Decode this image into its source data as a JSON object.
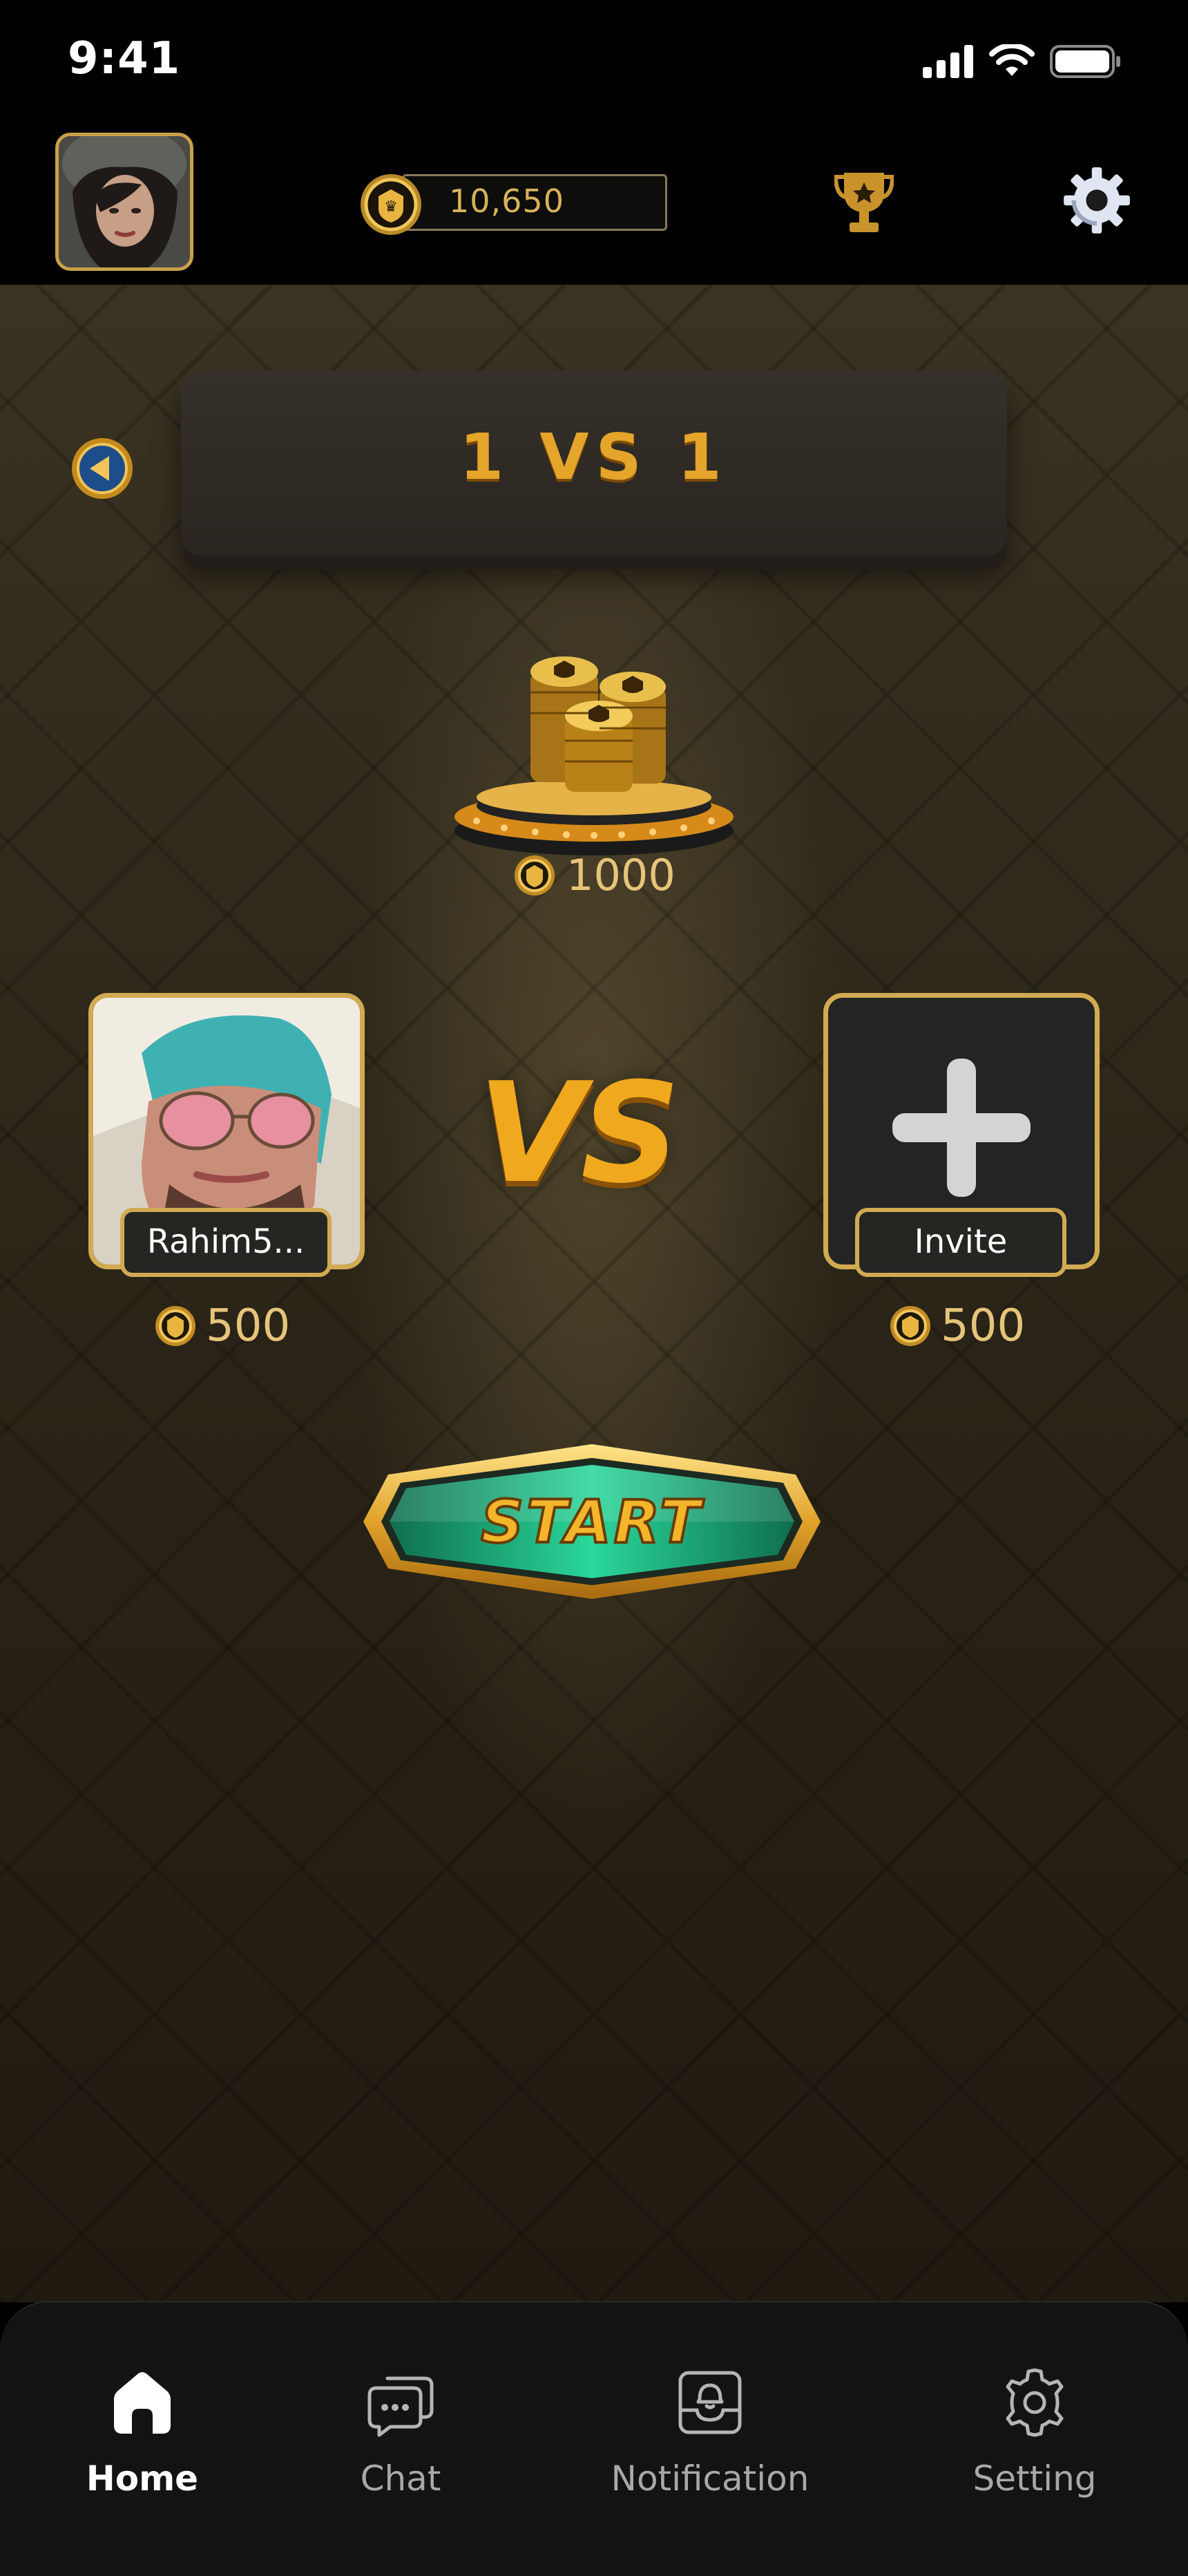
{
  "status_bar": {
    "time": "9:41"
  },
  "top_bar": {
    "coin_balance": "10,650"
  },
  "game": {
    "mode_title": "1 VS 1",
    "pot_amount": "1000",
    "vs_label": "VS",
    "player_left": {
      "name": "Rahim5...",
      "bet": "500"
    },
    "player_right": {
      "name": "Invite",
      "bet": "500"
    },
    "start_label": "START"
  },
  "nav": {
    "items": [
      {
        "label": "Home",
        "icon": "home-icon",
        "active": true
      },
      {
        "label": "Chat",
        "icon": "chat-icon",
        "active": false
      },
      {
        "label": "Notification",
        "icon": "notification-icon",
        "active": false
      },
      {
        "label": "Setting",
        "icon": "settings-icon",
        "active": false
      }
    ]
  },
  "colors": {
    "gold": "#d1aa52",
    "accent_orange": "#f0a91e",
    "start_green": "#1fa67a",
    "nav_bg": "#131313"
  }
}
